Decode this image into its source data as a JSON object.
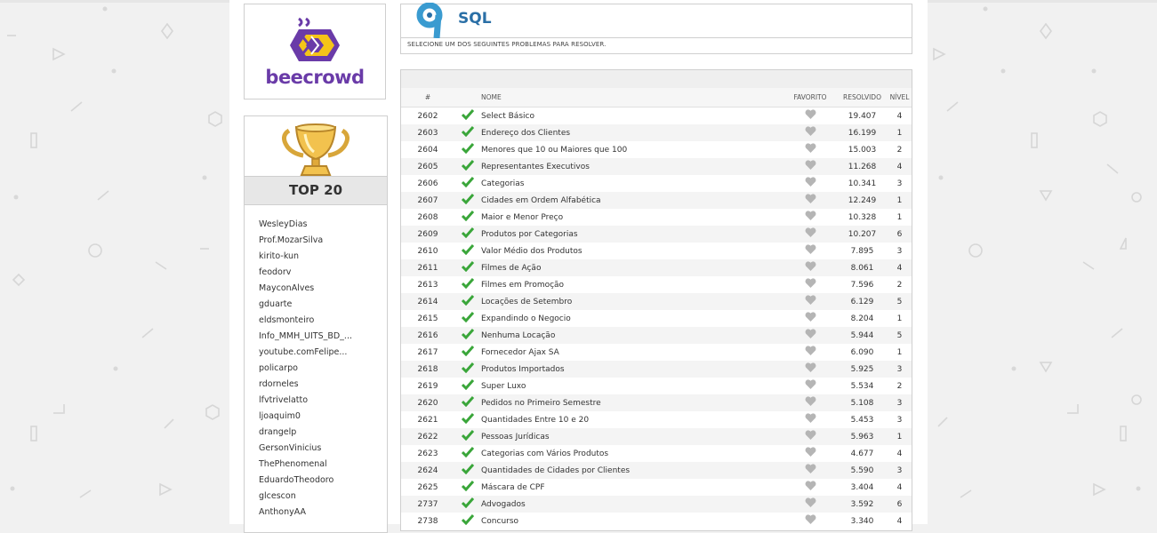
{
  "brand": {
    "name": "beecrowd",
    "purple": "#6a3ba8",
    "yellow": "#f5c518"
  },
  "ranking": {
    "title": "TOP 20",
    "users": [
      "WesleyDias",
      "Prof.MozarSilva",
      "kirito-kun",
      "feodorv",
      "MayconAlves",
      "gduarte",
      "eldsmonteiro",
      "Info_MMH_UITS_BD_...",
      "youtube.comFelipe...",
      "policarpo",
      "rdorneles",
      "lfvtrivelatto",
      "ljoaquim0",
      "drangelp",
      "GersonVinicius",
      "ThePhenomenal",
      "EduardoTheodoro",
      "glcescon",
      "AnthonyAA"
    ]
  },
  "category": {
    "title": "SQL",
    "subtitle": "SELECIONE UM DOS SEGUINTES PROBLEMAS PARA RESOLVER.",
    "accent": "#2a6fa6"
  },
  "table": {
    "headers": {
      "id": "#",
      "name": "NOME",
      "favorite": "FAVORITO",
      "solved": "RESOLVIDO",
      "level": "NÍVEL"
    },
    "rows": [
      {
        "id": "2602",
        "name": "Select Básico",
        "solved": "19.407",
        "level": "4"
      },
      {
        "id": "2603",
        "name": "Endereço dos Clientes",
        "solved": "16.199",
        "level": "1"
      },
      {
        "id": "2604",
        "name": "Menores que 10 ou Maiores que 100",
        "solved": "15.003",
        "level": "2"
      },
      {
        "id": "2605",
        "name": "Representantes Executivos",
        "solved": "11.268",
        "level": "4"
      },
      {
        "id": "2606",
        "name": "Categorias",
        "solved": "10.341",
        "level": "3"
      },
      {
        "id": "2607",
        "name": "Cidades em Ordem Alfabética",
        "solved": "12.249",
        "level": "1"
      },
      {
        "id": "2608",
        "name": "Maior e Menor Preço",
        "solved": "10.328",
        "level": "1"
      },
      {
        "id": "2609",
        "name": "Produtos por Categorias",
        "solved": "10.207",
        "level": "6"
      },
      {
        "id": "2610",
        "name": "Valor Médio dos Produtos",
        "solved": "7.895",
        "level": "3"
      },
      {
        "id": "2611",
        "name": "Filmes de Ação",
        "solved": "8.061",
        "level": "4"
      },
      {
        "id": "2613",
        "name": "Filmes em Promoção",
        "solved": "7.596",
        "level": "2"
      },
      {
        "id": "2614",
        "name": "Locações de Setembro",
        "solved": "6.129",
        "level": "5"
      },
      {
        "id": "2615",
        "name": "Expandindo o Negocio",
        "solved": "8.204",
        "level": "1"
      },
      {
        "id": "2616",
        "name": "Nenhuma Locação",
        "solved": "5.944",
        "level": "5"
      },
      {
        "id": "2617",
        "name": "Fornecedor Ajax SA",
        "solved": "6.090",
        "level": "1"
      },
      {
        "id": "2618",
        "name": "Produtos Importados",
        "solved": "5.925",
        "level": "3"
      },
      {
        "id": "2619",
        "name": "Super Luxo",
        "solved": "5.534",
        "level": "2"
      },
      {
        "id": "2620",
        "name": "Pedidos no Primeiro Semestre",
        "solved": "5.108",
        "level": "3"
      },
      {
        "id": "2621",
        "name": "Quantidades Entre 10 e 20",
        "solved": "5.453",
        "level": "3"
      },
      {
        "id": "2622",
        "name": "Pessoas Jurídicas",
        "solved": "5.963",
        "level": "1"
      },
      {
        "id": "2623",
        "name": "Categorias com Vários Produtos",
        "solved": "4.677",
        "level": "4"
      },
      {
        "id": "2624",
        "name": "Quantidades de Cidades por Clientes",
        "solved": "5.590",
        "level": "3"
      },
      {
        "id": "2625",
        "name": "Máscara de CPF",
        "solved": "3.404",
        "level": "4"
      },
      {
        "id": "2737",
        "name": "Advogados",
        "solved": "3.592",
        "level": "6"
      },
      {
        "id": "2738",
        "name": "Concurso",
        "solved": "3.340",
        "level": "4"
      }
    ],
    "check_color": "#3aa63a",
    "heart_color": "#b5b5b5"
  }
}
